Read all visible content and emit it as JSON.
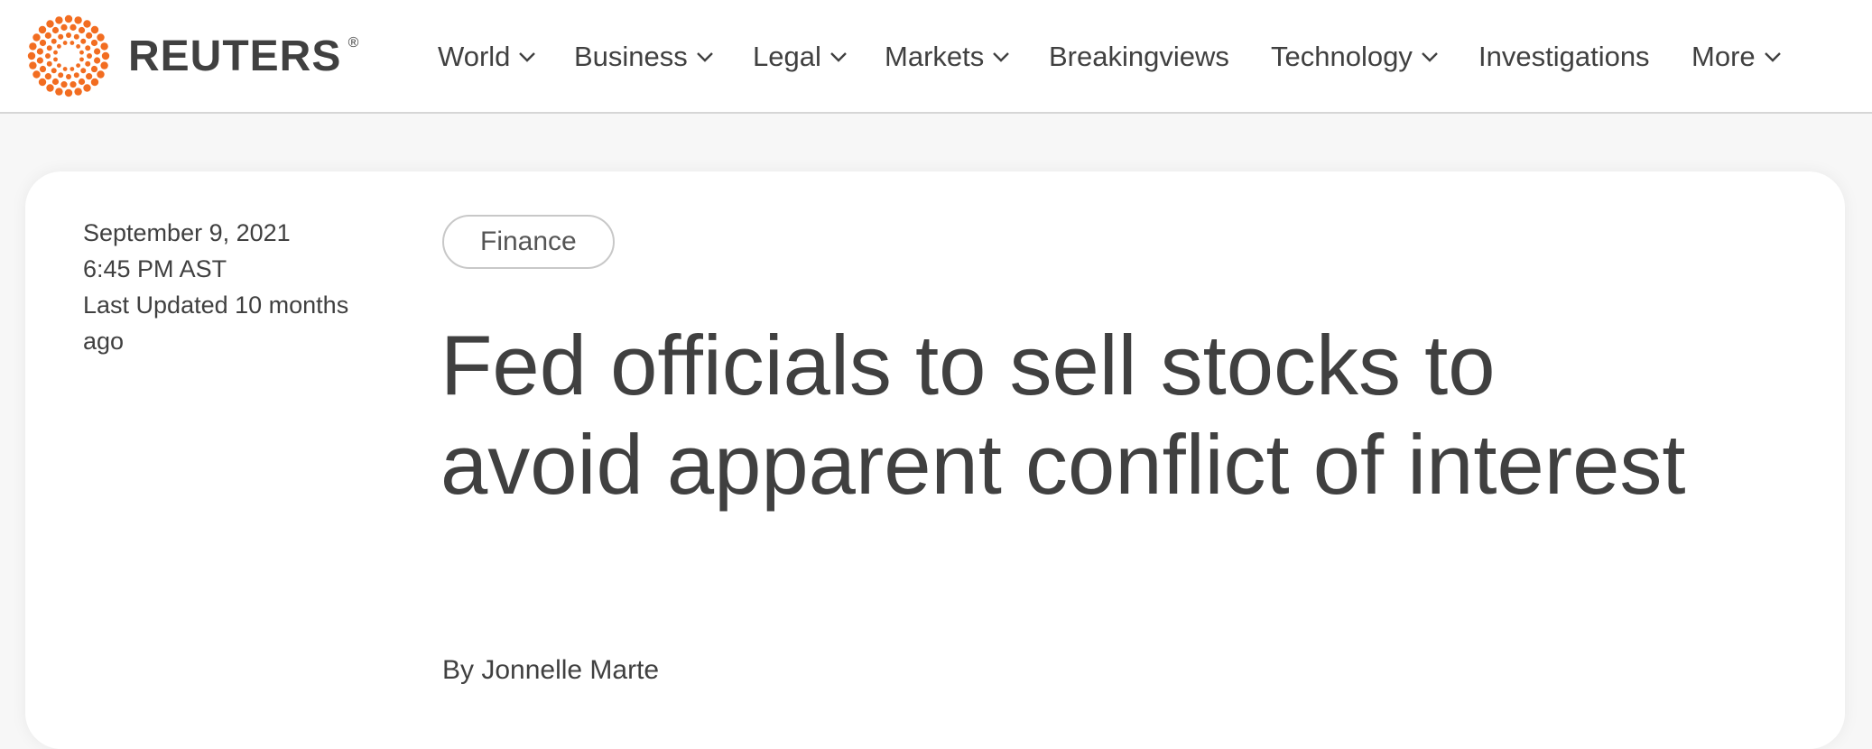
{
  "header": {
    "brand": "REUTERS",
    "registered_mark": "®",
    "accent_color": "#f26d21",
    "nav": [
      {
        "label": "World",
        "has_dropdown": true
      },
      {
        "label": "Business",
        "has_dropdown": true
      },
      {
        "label": "Legal",
        "has_dropdown": true
      },
      {
        "label": "Markets",
        "has_dropdown": true
      },
      {
        "label": "Breakingviews",
        "has_dropdown": false
      },
      {
        "label": "Technology",
        "has_dropdown": true
      },
      {
        "label": "Investigations",
        "has_dropdown": false
      },
      {
        "label": "More",
        "has_dropdown": true
      }
    ]
  },
  "article": {
    "date": "September 9, 2021",
    "time": "6:45 PM AST",
    "last_updated": "Last Updated 10 months ago",
    "category": "Finance",
    "headline": "Fed officials to sell stocks to avoid apparent conflict of interest",
    "byline": "By Jonnelle Marte"
  }
}
